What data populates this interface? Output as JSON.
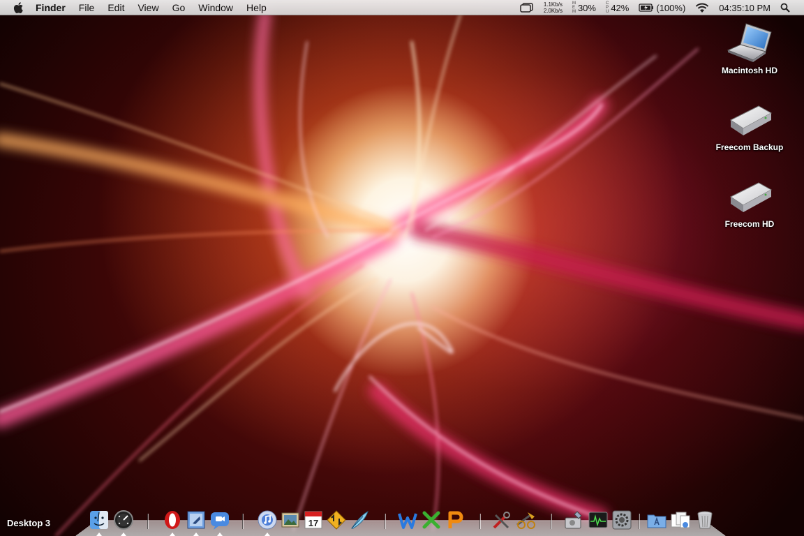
{
  "menubar": {
    "apple_icon": "apple-icon",
    "items": [
      "Finder",
      "File",
      "Edit",
      "View",
      "Go",
      "Window",
      "Help"
    ],
    "status": {
      "net_up": "1.1Kb/s",
      "net_down": "2.0Kb/s",
      "mem_label": [
        "M",
        "E",
        "M"
      ],
      "mem_percent": "30%",
      "cpu_label": [
        "C",
        "P",
        "U"
      ],
      "cpu_percent": "42%",
      "battery": "(100%)",
      "clock": "04:35:10 PM"
    }
  },
  "desktop": {
    "icons": [
      {
        "label": "Macintosh HD",
        "icon": "laptop-icon"
      },
      {
        "label": "Freecom Backup",
        "icon": "external-drive-icon"
      },
      {
        "label": "Freecom HD",
        "icon": "external-drive-icon"
      }
    ],
    "space_label": "Desktop 3",
    "calendar_day": "17"
  },
  "dock": {
    "items": [
      {
        "name": "finder-icon",
        "running": true
      },
      {
        "name": "dashboard-icon",
        "running": true
      },
      {
        "name": "opera-icon",
        "running": true
      },
      {
        "name": "mail-icon",
        "running": true
      },
      {
        "name": "ichat-icon",
        "running": true
      },
      {
        "name": "itunes-icon",
        "running": true
      },
      {
        "name": "iphoto-icon",
        "running": false
      },
      {
        "name": "ical-icon",
        "running": false
      },
      {
        "name": "transmit-icon",
        "running": false
      },
      {
        "name": "quill-icon",
        "running": false
      },
      {
        "name": "word-icon",
        "running": false
      },
      {
        "name": "excel-icon",
        "running": false
      },
      {
        "name": "powerpoint-icon",
        "running": false
      },
      {
        "name": "tools-icon",
        "running": false
      },
      {
        "name": "xcode-icon",
        "running": false
      },
      {
        "name": "disk-utility-icon",
        "running": false
      },
      {
        "name": "activity-monitor-icon",
        "running": false
      },
      {
        "name": "system-preferences-icon",
        "running": false
      },
      {
        "name": "applications-folder-icon",
        "running": false
      },
      {
        "name": "documents-stack-icon",
        "running": false
      },
      {
        "name": "trash-icon",
        "running": false
      }
    ]
  },
  "colors": {
    "menubar": "#e8e8e8",
    "wallpaper_core": "#ffffff",
    "wallpaper_glow": "#ffa040",
    "wallpaper_pink": "#e03070",
    "wallpaper_dark": "#3a0606"
  }
}
